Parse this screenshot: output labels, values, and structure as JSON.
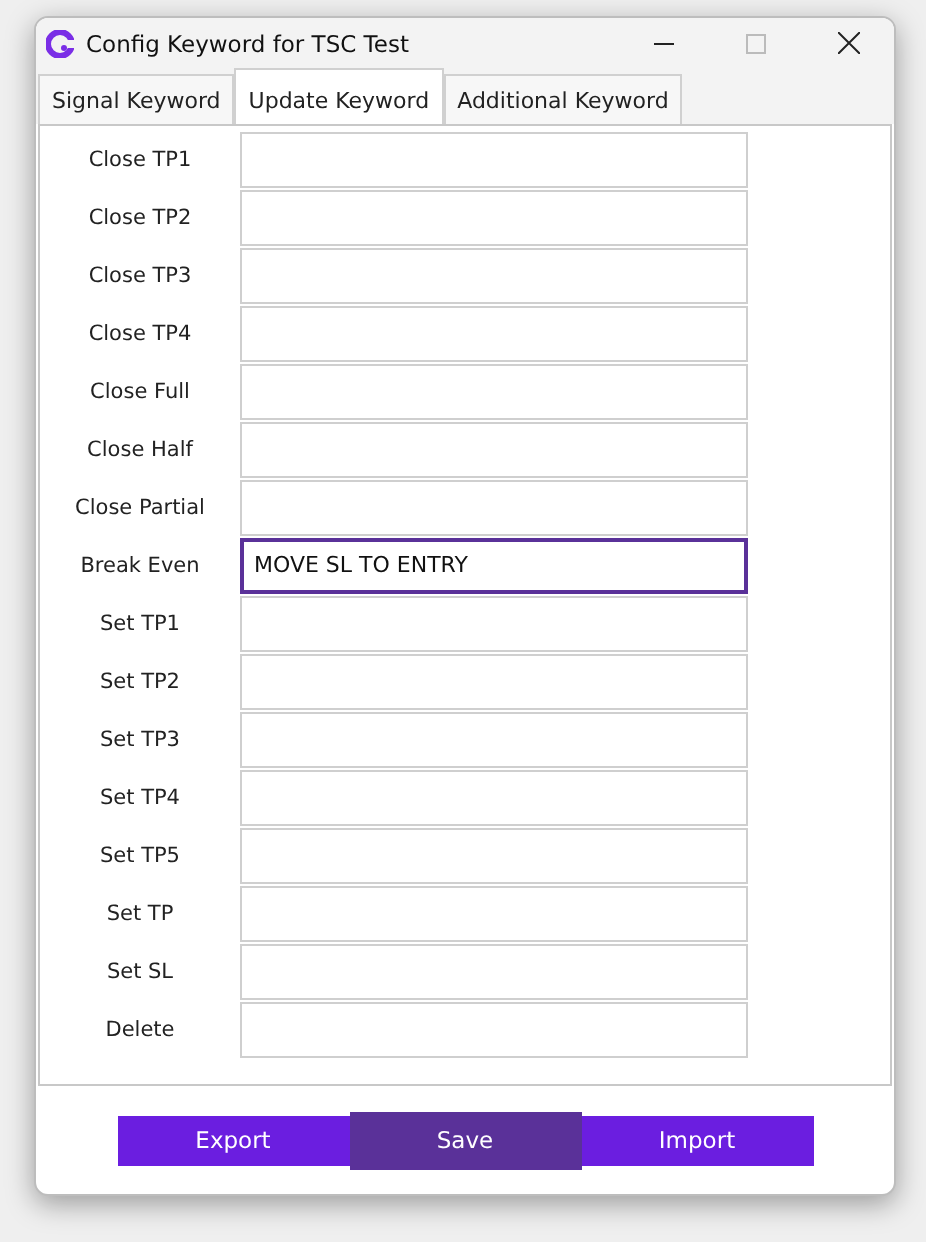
{
  "window": {
    "title": "Config Keyword for TSC Test"
  },
  "tabs": [
    {
      "label": "Signal Keyword",
      "selected": false
    },
    {
      "label": "Update Keyword",
      "selected": true
    },
    {
      "label": "Additional Keyword",
      "selected": false
    }
  ],
  "fields": [
    {
      "label": "Close TP1",
      "focused": false
    },
    {
      "label": "Close TP2",
      "focused": false
    },
    {
      "label": "Close TP3",
      "focused": false
    },
    {
      "label": "Close TP4",
      "focused": false
    },
    {
      "label": "Close Full",
      "focused": false
    },
    {
      "label": "Close Half",
      "focused": false
    },
    {
      "label": "Close Partial",
      "focused": false
    },
    {
      "label": "Break Even",
      "value": "MOVE SL TO ENTRY",
      "focused": true
    },
    {
      "label": "Set TP1",
      "focused": false
    },
    {
      "label": "Set TP2",
      "focused": false
    },
    {
      "label": "Set TP3",
      "focused": false
    },
    {
      "label": "Set TP4",
      "focused": false
    },
    {
      "label": "Set TP5",
      "focused": false
    },
    {
      "label": "Set TP",
      "focused": false
    },
    {
      "label": "Set SL",
      "focused": false
    },
    {
      "label": "Delete",
      "focused": false
    }
  ],
  "buttons": [
    {
      "label": "Export",
      "focused": false
    },
    {
      "label": "Save",
      "focused": true
    },
    {
      "label": "Import",
      "focused": false
    }
  ]
}
